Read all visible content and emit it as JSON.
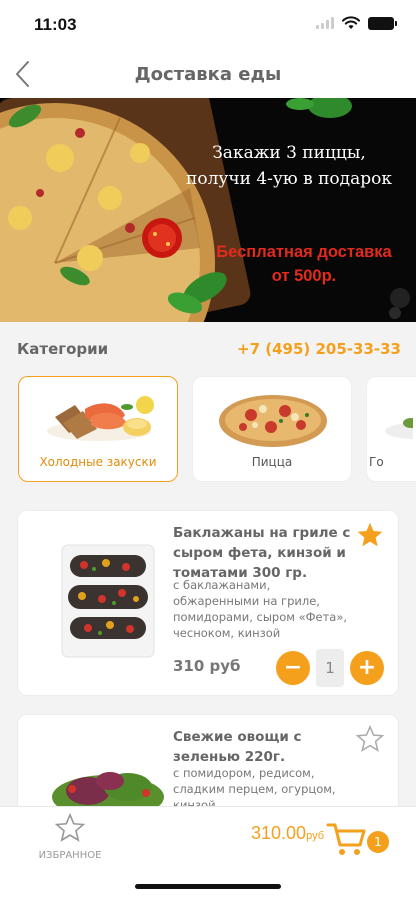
{
  "status": {
    "time": "11:03"
  },
  "nav": {
    "title": "Доставка еды"
  },
  "banner": {
    "line1": "Закажи 3 пиццы,",
    "line2": "получи 4-ую в подарок",
    "line3": "Бесплатная доставка",
    "line4": "от 500р."
  },
  "categories_section": {
    "label": "Категории",
    "phone": "+7 (495) 205-33-33"
  },
  "categories": [
    {
      "label": "Холодные закуски",
      "selected": true
    },
    {
      "label": "Пицца",
      "selected": false
    },
    {
      "label": "Го",
      "selected": false
    }
  ],
  "products": [
    {
      "name": "Баклажаны на гриле с сыром фета, кинзой и томатами    300 гр.",
      "desc": "с баклажанами, обжаренными на гриле, помидорами, сыром «Фета», чесноком, кинзой",
      "price": "310 руб",
      "qty": "1",
      "favorite": true
    },
    {
      "name": "Свежие овощи с зеленью 220г.",
      "desc": "с помидором, редисом, сладким перцем, огурцом, кинзой.",
      "favorite": false
    }
  ],
  "bottom": {
    "fav_label": "ИЗБРАННОЕ",
    "total": "310.00",
    "currency": "руб",
    "cart_count": "1"
  },
  "colors": {
    "accent": "#f4a01d",
    "promo_red": "#e42a1d",
    "background": "#f3f3f3"
  }
}
